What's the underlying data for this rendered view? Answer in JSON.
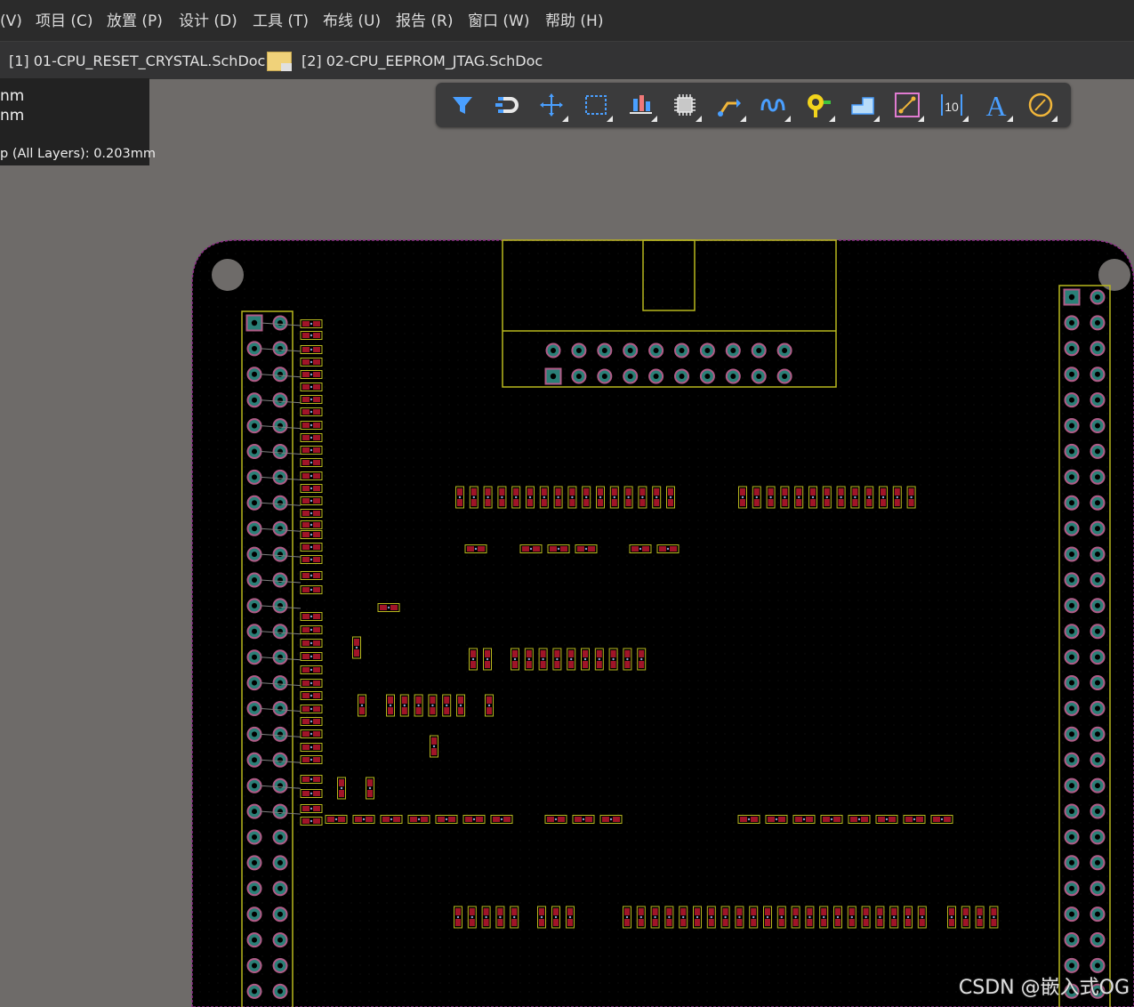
{
  "menubar": {
    "items": [
      "(V)",
      "项目 (C)",
      "放置 (P)",
      "设计 (D)",
      "工具 (T)",
      "布线 (U)",
      "报告 (R)",
      "窗口 (W)",
      "帮助 (H)"
    ]
  },
  "tabs": [
    {
      "label": "[1] 01-CPU_RESET_CRYSTAL.SchDoc",
      "icon": "schematic-doc-icon"
    },
    {
      "label": "[2] 02-CPU_EEPROM_JTAG.SchDoc",
      "icon": "schematic-doc-icon"
    }
  ],
  "info_panel": {
    "line1": "nm",
    "line2": "nm",
    "line3": "p (All Layers): 0.203mm"
  },
  "toolbar": {
    "buttons": [
      {
        "name": "filter-icon"
      },
      {
        "name": "snap-magnet-icon"
      },
      {
        "name": "move-cross-icon"
      },
      {
        "name": "select-rectangle-icon"
      },
      {
        "name": "align-icon"
      },
      {
        "name": "component-icon"
      },
      {
        "name": "route-track-icon"
      },
      {
        "name": "interactive-length-tuning-icon"
      },
      {
        "name": "place-via-icon"
      },
      {
        "name": "place-polygon-icon"
      },
      {
        "name": "place-dimension-line-icon"
      },
      {
        "name": "place-dimension-icon"
      },
      {
        "name": "place-string-icon"
      },
      {
        "name": "place-arc-icon"
      }
    ],
    "dimension_text": "10",
    "string_text": "A"
  },
  "colors": {
    "board": "#000000",
    "board_outline": "#8e2c87",
    "silkscreen": "#b8b81e",
    "pad": "#2a7f77",
    "pad_ring": "#b05b86",
    "smd_pad": "#a11428",
    "toolbar_accent": "#4a9fff"
  },
  "watermark": "CSDN @嵌入式OG"
}
